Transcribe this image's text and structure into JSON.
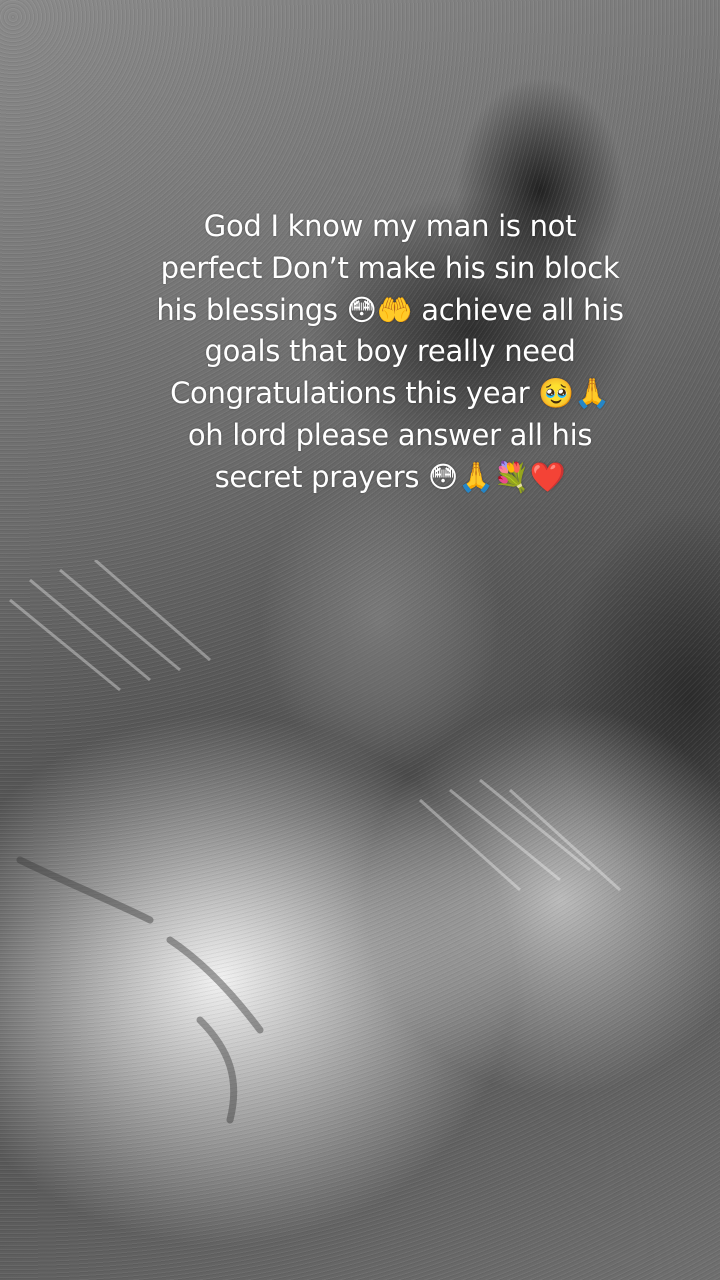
{
  "caption": {
    "text": "God I know my man is not perfect Don’t make his sin block his blessings 😳🤲 achieve all his goals that boy really need Congratulations this year 🥹🙏 oh lord please answer all his secret prayers 😳🙏💐❤️"
  },
  "background": {
    "description_icon": "grayscale-photo-background"
  }
}
